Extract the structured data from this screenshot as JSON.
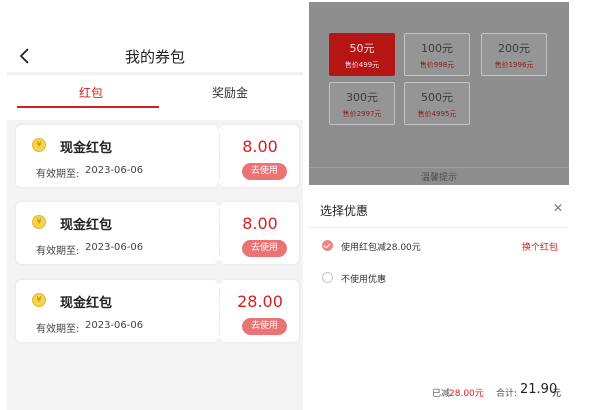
{
  "left": {
    "nav": {
      "title": "我的券包",
      "back_icon": "chevron-left-icon"
    },
    "tabs": [
      {
        "label": "红包",
        "active": true
      },
      {
        "label": "奖励金",
        "active": false
      }
    ],
    "cards": [
      {
        "title": "现金红包",
        "expiry_label": "有效期至:",
        "expiry_date": "2023-06-06",
        "amount": "8.00",
        "button": "去使用"
      },
      {
        "title": "现金红包",
        "expiry_label": "有效期至:",
        "expiry_date": "2023-06-06",
        "amount": "8.00",
        "button": "去使用"
      },
      {
        "title": "现金红包",
        "expiry_label": "有效期至:",
        "expiry_date": "2023-06-06",
        "amount": "28.00",
        "button": "去使用"
      }
    ],
    "coin_symbol": "¥"
  },
  "right": {
    "options": [
      {
        "value": "50元",
        "price": "售价499元",
        "selected": true
      },
      {
        "value": "100元",
        "price": "售价998元",
        "selected": false
      },
      {
        "value": "200元",
        "price": "售价1996元",
        "selected": false
      },
      {
        "value": "300元",
        "price": "售价2997元",
        "selected": false
      },
      {
        "value": "500元",
        "price": "售价4995元",
        "selected": false
      }
    ],
    "tip": "温馨提示",
    "sheet": {
      "title": "选择优惠",
      "close_icon": "close-icon",
      "option_use": "使用红包减28.00元",
      "option_none": "不使用优惠",
      "change_link": "换个红包"
    },
    "summary": {
      "reduced_label": "已减",
      "reduced_value": "28.00元",
      "total_label": "合计:",
      "total_value": "21.90",
      "total_unit": "元"
    }
  },
  "colors": {
    "accent": "#d81e1e",
    "button": "#ea7474",
    "overlay": "#8e8e8e"
  }
}
